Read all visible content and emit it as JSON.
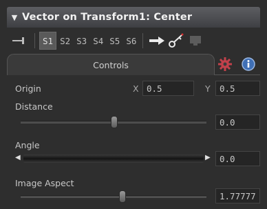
{
  "title_bar": {
    "collapse_icon": "triangle-down",
    "title": "Vector on Transform1: Center"
  },
  "toolbar": {
    "pin_icon": "pin",
    "slots": [
      "S1",
      "S2",
      "S3",
      "S4",
      "S5",
      "S6"
    ],
    "active_slot": "S1",
    "tools": [
      "arrow-right-icon",
      "key-icon",
      "monitor-icon"
    ]
  },
  "tabs": {
    "controls_label": "Controls",
    "icons": [
      "gear-icon",
      "info-icon"
    ]
  },
  "controls": {
    "origin": {
      "label": "Origin",
      "x_label": "X",
      "x_value": "0.5",
      "y_label": "Y",
      "y_value": "0.5"
    },
    "distance": {
      "label": "Distance",
      "value": "0.0",
      "slider_position": 0.5
    },
    "angle": {
      "label": "Angle",
      "value": "0.0"
    },
    "image_aspect": {
      "label": "Image Aspect",
      "value": "1.77777",
      "slider_position": 0.55
    }
  },
  "colors": {
    "background": "#2e2e2e",
    "title_bar": "#4d4e52",
    "field": "#252525",
    "accent_gear": "#c2414b",
    "accent_info": "#3f6fb5"
  }
}
